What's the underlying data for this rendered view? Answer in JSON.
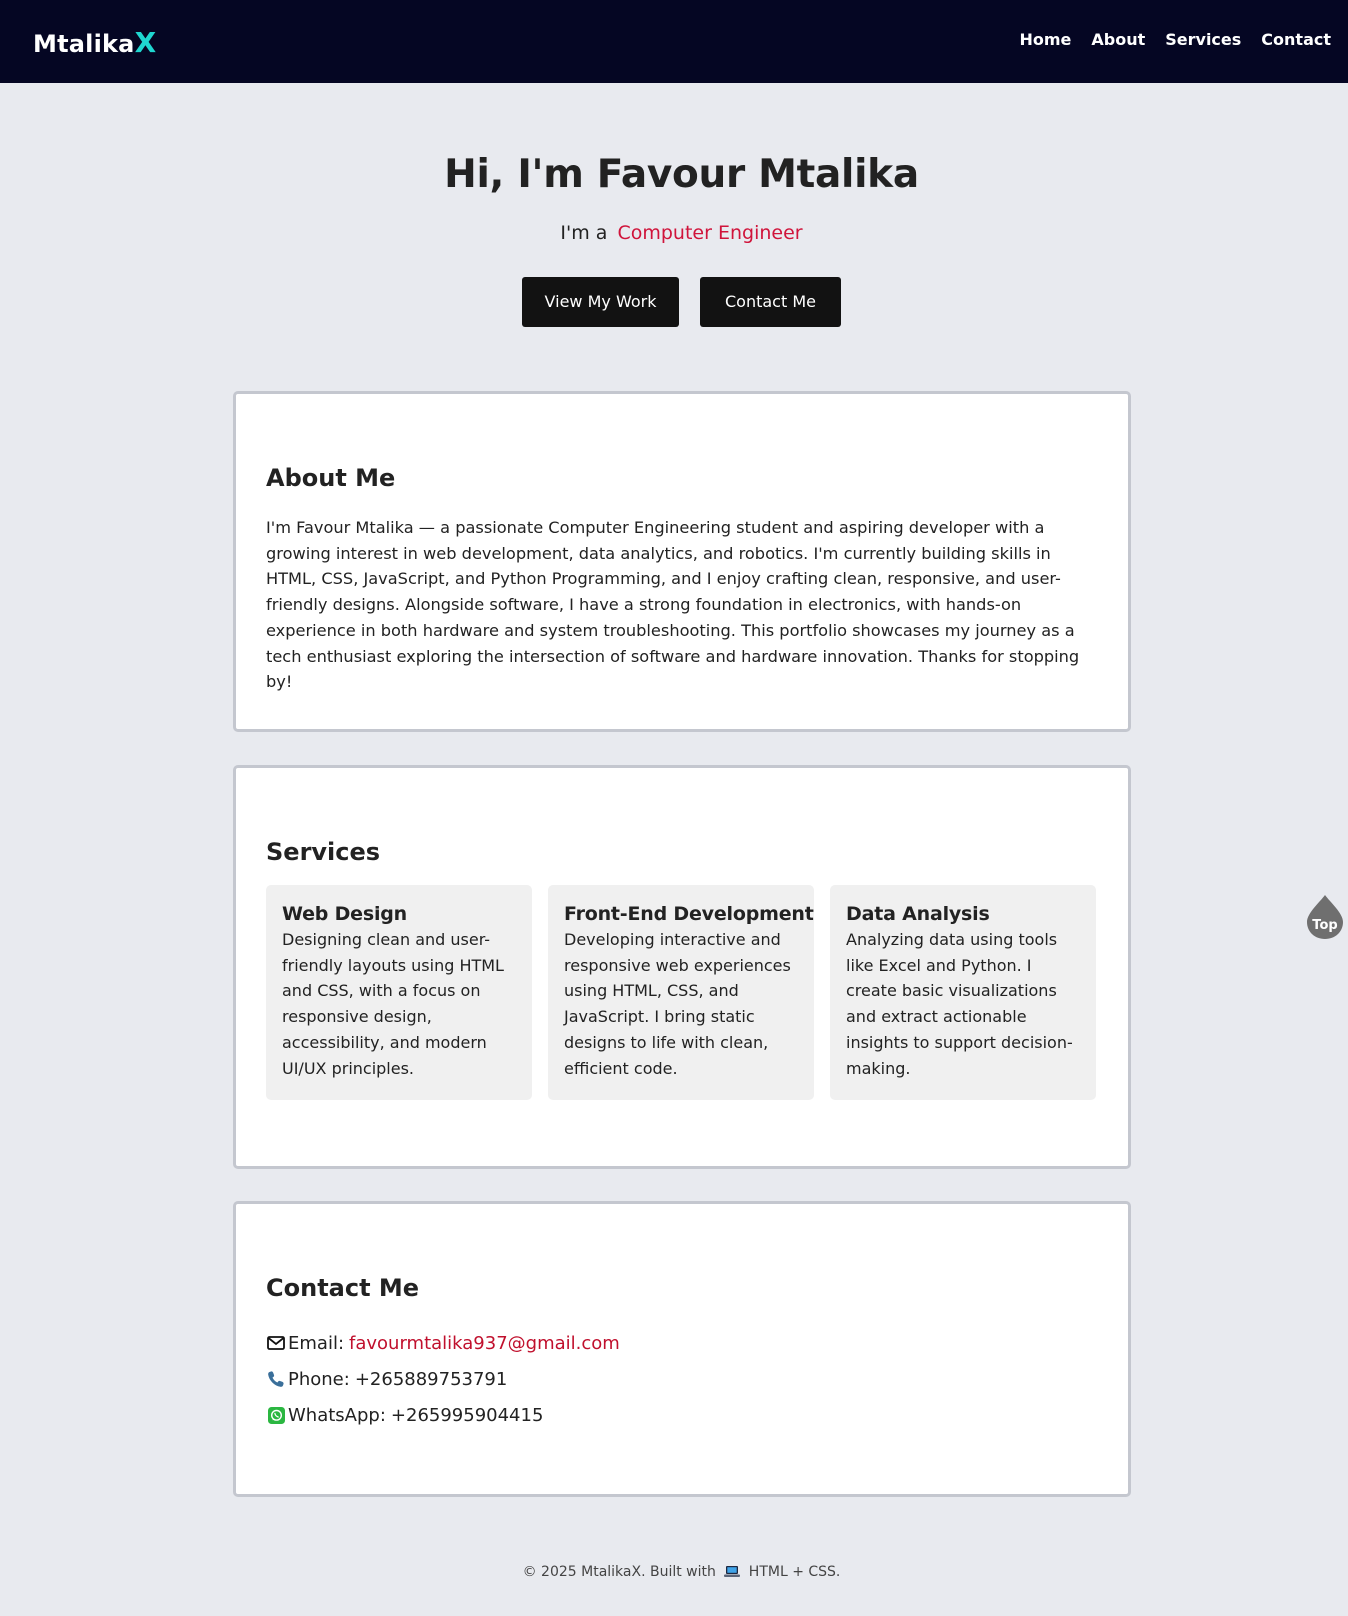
{
  "brand": {
    "name": "Mtalika",
    "accent_letter": "X",
    "accent_color": "#1fd6d0",
    "nav_bg": "#050623"
  },
  "nav": {
    "links": [
      "Home",
      "About",
      "Services",
      "Contact"
    ]
  },
  "hero": {
    "title": "Hi, I'm Favour Mtalika",
    "sub_prefix": "I'm a",
    "role": "Computer Engineer",
    "role_color": "#d0143b",
    "buttons": {
      "work": "View My Work",
      "contact": "Contact Me"
    }
  },
  "about": {
    "heading": "About Me",
    "text": "I'm Favour Mtalika — a passionate Computer Engineering student and aspiring developer with a growing interest in web development, data analytics, and robotics. I'm currently building skills in HTML, CSS, JavaScript, and Python Programming, and I enjoy crafting clean, responsive, and user-friendly designs. Alongside software, I have a strong foundation in electronics, with hands-on experience in both hardware and system troubleshooting. This portfolio showcases my journey as a tech enthusiast exploring the intersection of software and hardware innovation. Thanks for stopping by!"
  },
  "services": {
    "heading": "Services",
    "items": [
      {
        "title": "Web Design",
        "text": "Designing clean and user-friendly layouts using HTML and CSS, with a focus on responsive design, accessibility, and modern UI/UX principles."
      },
      {
        "title": "Front-End Development",
        "text": "Developing interactive and responsive web experiences using HTML, CSS, and JavaScript. I bring static designs to life with clean, efficient code."
      },
      {
        "title": "Data Analysis",
        "text": "Analyzing data using tools like Excel and Python. I create basic visualizations and extract actionable insights to support decision-making."
      }
    ]
  },
  "contact": {
    "heading": "Contact Me",
    "email_label": "Email:",
    "email": "favourmtalika937@gmail.com",
    "phone_label": "Phone:",
    "phone": "+265889753791",
    "whatsapp_label": "WhatsApp:",
    "whatsapp": "+265995904415",
    "icons": [
      "envelope-icon",
      "phone-icon",
      "whatsapp-icon"
    ]
  },
  "top_button": {
    "label": "Top"
  },
  "footer": {
    "prefix": "© 2025 MtalikaX. Built with",
    "suffix": "HTML + CSS."
  }
}
